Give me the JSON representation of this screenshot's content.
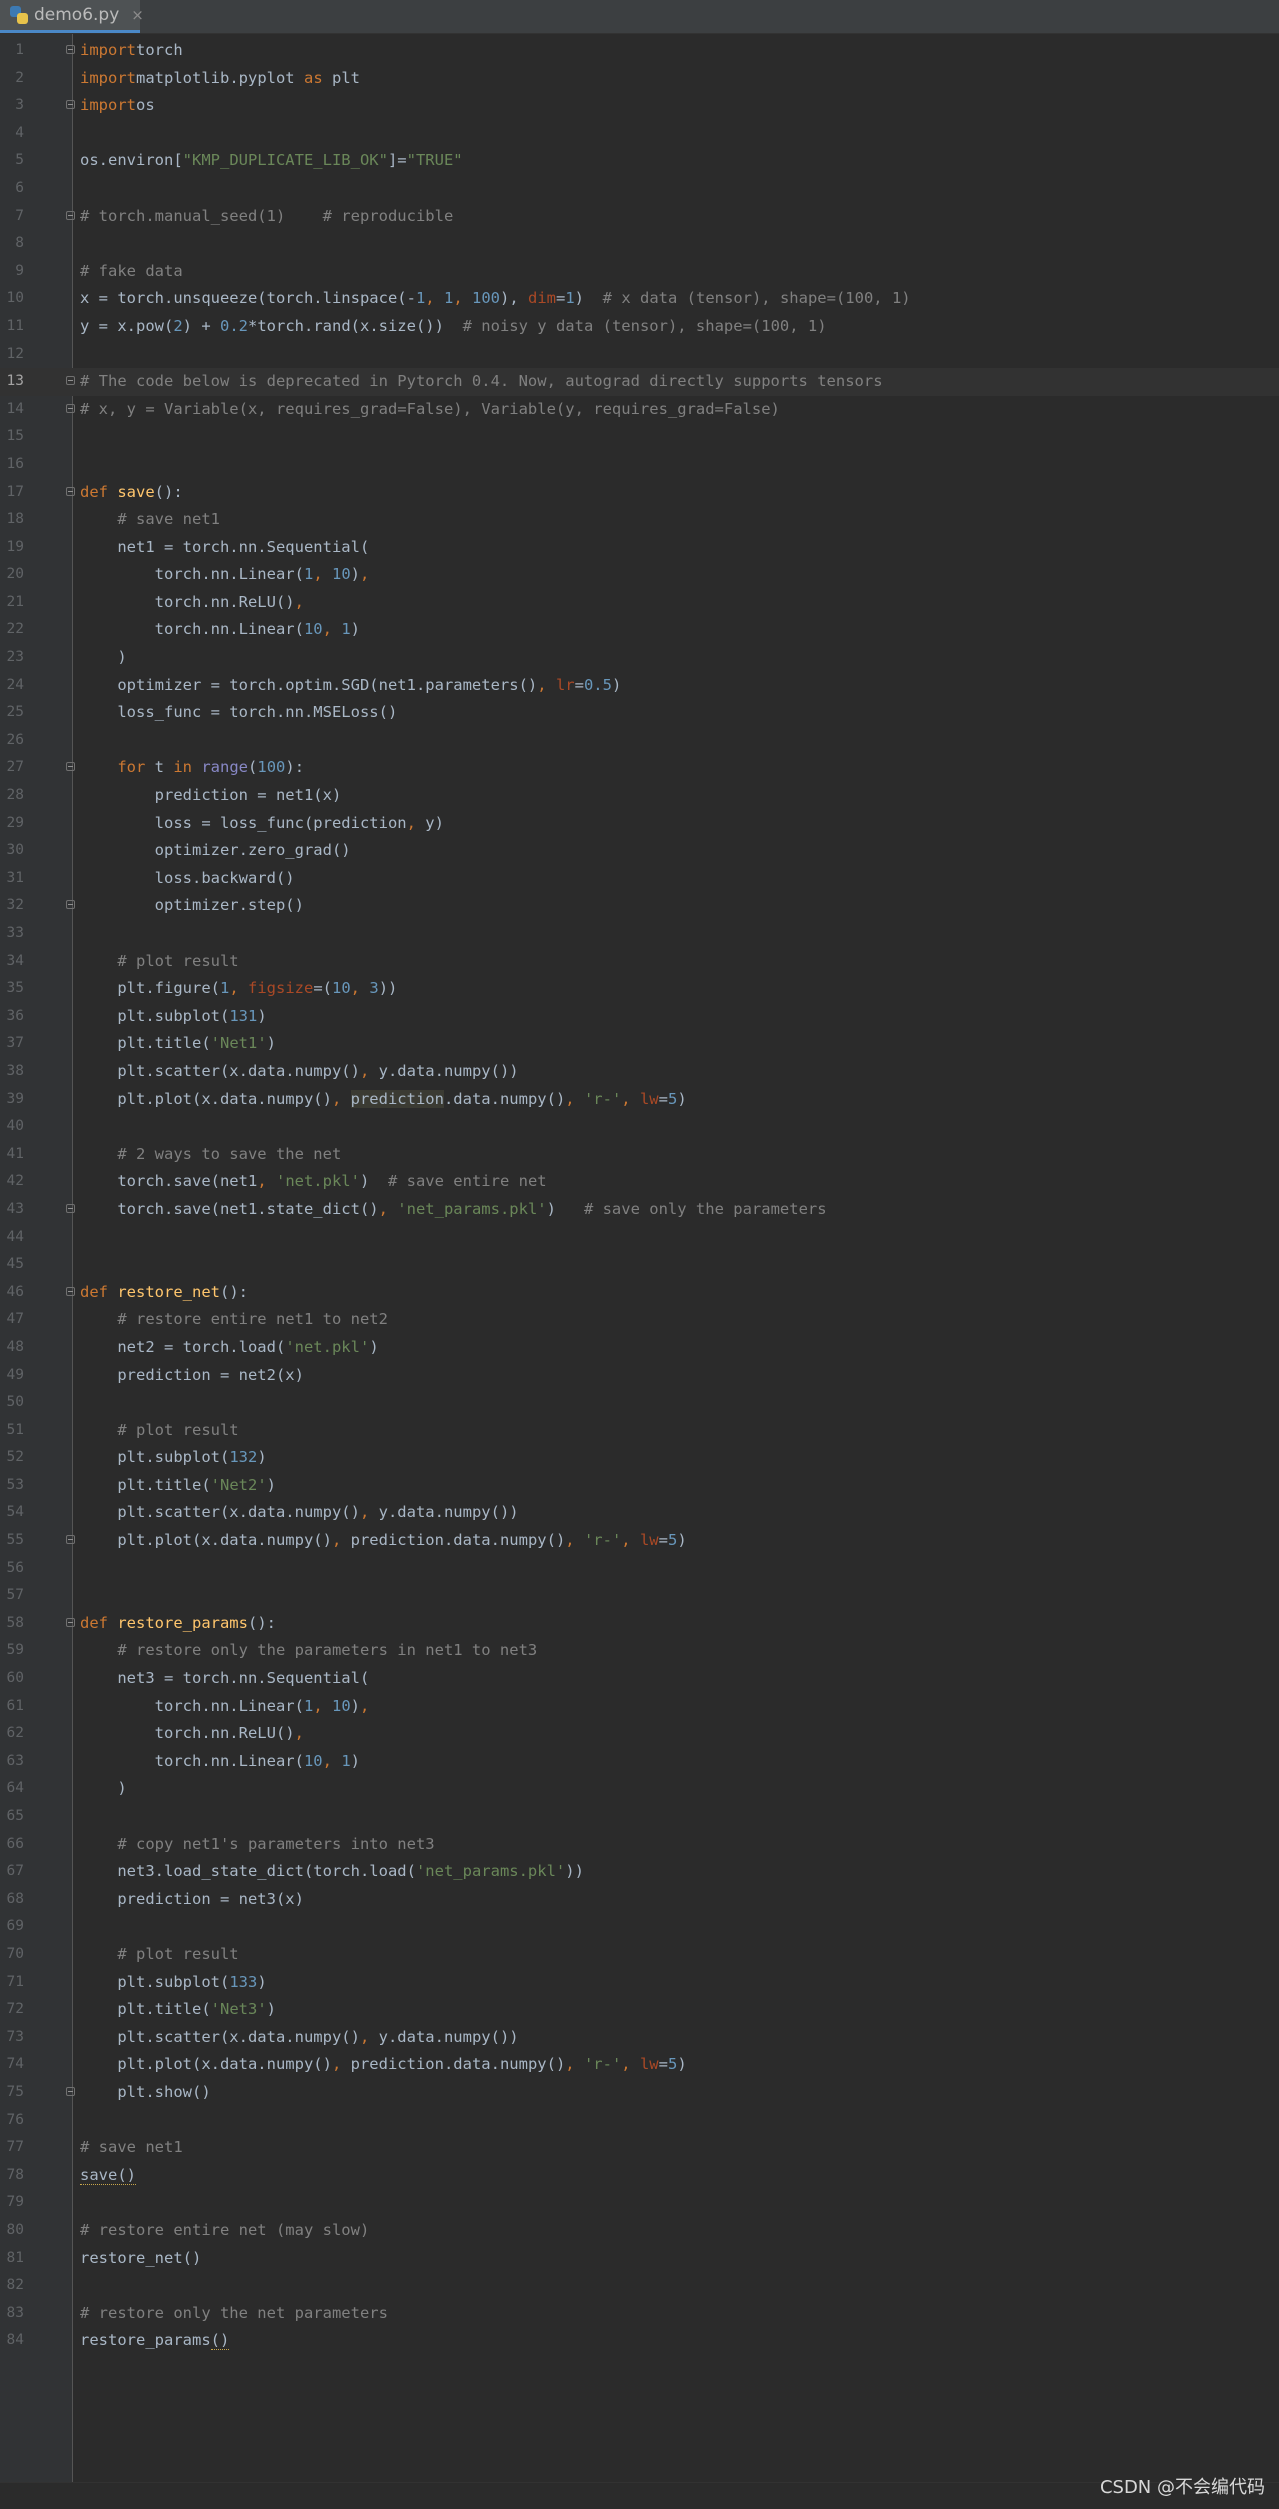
{
  "editor": {
    "tab": {
      "filename": "demo6.py",
      "icon": "python-file-icon",
      "close_glyph": "×"
    },
    "current_line": 13,
    "lines": [
      {
        "n": "1",
        "fold": true,
        "t": [
          [
            "kw",
            "import"
          ],
          [
            "",
            "torch"
          ]
        ]
      },
      {
        "n": "2",
        "t": [
          [
            "kw",
            "import"
          ],
          [
            "",
            "matplotlib.pyplot "
          ],
          [
            "kw",
            "as"
          ],
          [
            "",
            " plt"
          ]
        ]
      },
      {
        "n": "3",
        "fold": true,
        "t": [
          [
            "kw",
            "import"
          ],
          [
            "",
            "os"
          ]
        ]
      },
      {
        "n": "4",
        "t": []
      },
      {
        "n": "5",
        "t": [
          [
            "",
            "os.environ["
          ],
          [
            "st",
            "\"KMP_DUPLICATE_LIB_OK\""
          ],
          [
            "",
            "]="
          ],
          [
            "st",
            "\"TRUE\""
          ]
        ]
      },
      {
        "n": "6",
        "t": []
      },
      {
        "n": "7",
        "fold": true,
        "t": [
          [
            "cm",
            "# torch.manual_seed(1)    # reproducible"
          ]
        ]
      },
      {
        "n": "8",
        "t": []
      },
      {
        "n": "9",
        "t": [
          [
            "cm",
            "# fake data"
          ]
        ]
      },
      {
        "n": "10",
        "t": [
          [
            "",
            "x = torch.unsqueeze(torch.linspace(-"
          ],
          [
            "nm",
            "1"
          ],
          [
            "kw",
            ", "
          ],
          [
            "nm",
            "1"
          ],
          [
            "kw",
            ", "
          ],
          [
            "nm",
            "100"
          ],
          [
            "",
            "), "
          ],
          [
            "pr",
            "dim"
          ],
          [
            "",
            "="
          ],
          [
            "nm",
            "1"
          ],
          [
            "",
            ")  "
          ],
          [
            "cm",
            "# x data (tensor), shape=(100, 1)"
          ]
        ]
      },
      {
        "n": "11",
        "t": [
          [
            "",
            "y = x.pow("
          ],
          [
            "nm",
            "2"
          ],
          [
            "",
            ") + "
          ],
          [
            "nm",
            "0.2"
          ],
          [
            "",
            "*torch.rand(x.size())  "
          ],
          [
            "cm",
            "# noisy y data (tensor), shape=(100, 1)"
          ]
        ]
      },
      {
        "n": "12",
        "t": []
      },
      {
        "n": "13",
        "fold": true,
        "t": [
          [
            "cm",
            "# The code below is deprecated in Pytorch 0.4. Now, autograd directly supports tensors"
          ]
        ]
      },
      {
        "n": "14",
        "fold": true,
        "t": [
          [
            "cm",
            "# x, y = Variable(x, requires_grad=False), Variable(y, requires_grad=False)"
          ]
        ]
      },
      {
        "n": "15",
        "t": []
      },
      {
        "n": "16",
        "t": []
      },
      {
        "n": "17",
        "fold": true,
        "t": [
          [
            "kw",
            "def "
          ],
          [
            "fn",
            "save"
          ],
          [
            "",
            "():"
          ]
        ]
      },
      {
        "n": "18",
        "t": [
          [
            "",
            "    "
          ],
          [
            "cm",
            "# save net1"
          ]
        ]
      },
      {
        "n": "19",
        "t": [
          [
            "",
            "    net1 = torch.nn.Sequential("
          ]
        ]
      },
      {
        "n": "20",
        "t": [
          [
            "",
            "        torch.nn.Linear("
          ],
          [
            "nm",
            "1"
          ],
          [
            "kw",
            ", "
          ],
          [
            "nm",
            "10"
          ],
          [
            "",
            ")"
          ],
          [
            "kw",
            ","
          ]
        ]
      },
      {
        "n": "21",
        "t": [
          [
            "",
            "        torch.nn.ReLU()"
          ],
          [
            "kw",
            ","
          ]
        ]
      },
      {
        "n": "22",
        "t": [
          [
            "",
            "        torch.nn.Linear("
          ],
          [
            "nm",
            "10"
          ],
          [
            "kw",
            ", "
          ],
          [
            "nm",
            "1"
          ],
          [
            "",
            ")"
          ]
        ]
      },
      {
        "n": "23",
        "t": [
          [
            "",
            "    )"
          ]
        ]
      },
      {
        "n": "24",
        "t": [
          [
            "",
            "    optimizer = torch.optim.SGD(net1.parameters()"
          ],
          [
            "kw",
            ", "
          ],
          [
            "pr",
            "lr"
          ],
          [
            "",
            "="
          ],
          [
            "nm",
            "0.5"
          ],
          [
            "",
            ")"
          ]
        ]
      },
      {
        "n": "25",
        "t": [
          [
            "",
            "    loss_func = torch.nn.MSELoss()"
          ]
        ]
      },
      {
        "n": "26",
        "t": []
      },
      {
        "n": "27",
        "fold": true,
        "t": [
          [
            "",
            "    "
          ],
          [
            "kw",
            "for"
          ],
          [
            "",
            " t "
          ],
          [
            "kw",
            "in"
          ],
          [
            "",
            " "
          ],
          [
            "bi",
            "range"
          ],
          [
            "",
            "("
          ],
          [
            "nm",
            "100"
          ],
          [
            "",
            "):"
          ]
        ]
      },
      {
        "n": "28",
        "t": [
          [
            "",
            "        prediction = net1(x)"
          ]
        ]
      },
      {
        "n": "29",
        "t": [
          [
            "",
            "        loss = loss_func(prediction"
          ],
          [
            "kw",
            ", "
          ],
          [
            "",
            "y)"
          ]
        ]
      },
      {
        "n": "30",
        "t": [
          [
            "",
            "        optimizer.zero_grad()"
          ]
        ]
      },
      {
        "n": "31",
        "t": [
          [
            "",
            "        loss.backward()"
          ]
        ]
      },
      {
        "n": "32",
        "fold": true,
        "t": [
          [
            "",
            "        optimizer.step()"
          ]
        ]
      },
      {
        "n": "33",
        "t": []
      },
      {
        "n": "34",
        "t": [
          [
            "",
            "    "
          ],
          [
            "cm",
            "# plot result"
          ]
        ]
      },
      {
        "n": "35",
        "t": [
          [
            "",
            "    plt.figure("
          ],
          [
            "nm",
            "1"
          ],
          [
            "kw",
            ", "
          ],
          [
            "pr",
            "figsize"
          ],
          [
            "",
            "=("
          ],
          [
            "nm",
            "10"
          ],
          [
            "kw",
            ", "
          ],
          [
            "nm",
            "3"
          ],
          [
            "",
            "))"
          ]
        ]
      },
      {
        "n": "36",
        "t": [
          [
            "",
            "    plt.subplot("
          ],
          [
            "nm",
            "131"
          ],
          [
            "",
            ")"
          ]
        ]
      },
      {
        "n": "37",
        "t": [
          [
            "",
            "    plt.title("
          ],
          [
            "st",
            "'Net1'"
          ],
          [
            "",
            ")"
          ]
        ]
      },
      {
        "n": "38",
        "t": [
          [
            "",
            "    plt.scatter(x.data.numpy()"
          ],
          [
            "kw",
            ", "
          ],
          [
            "",
            "y.data.numpy())"
          ]
        ]
      },
      {
        "n": "39",
        "t": [
          [
            "",
            "    plt.plot(x.data.numpy()"
          ],
          [
            "kw",
            ", "
          ],
          [
            "hl",
            "prediction"
          ],
          [
            "",
            ".data.numpy()"
          ],
          [
            "kw",
            ", "
          ],
          [
            "st",
            "'r-'"
          ],
          [
            "kw",
            ", "
          ],
          [
            "pr",
            "lw"
          ],
          [
            "",
            "="
          ],
          [
            "nm",
            "5"
          ],
          [
            "",
            ")"
          ]
        ]
      },
      {
        "n": "40",
        "t": []
      },
      {
        "n": "41",
        "t": [
          [
            "",
            "    "
          ],
          [
            "cm",
            "# 2 ways to save the net"
          ]
        ]
      },
      {
        "n": "42",
        "t": [
          [
            "",
            "    torch.save(net1"
          ],
          [
            "kw",
            ", "
          ],
          [
            "st",
            "'net.pkl'"
          ],
          [
            "",
            ")  "
          ],
          [
            "cm",
            "# save entire net"
          ]
        ]
      },
      {
        "n": "43",
        "fold": true,
        "t": [
          [
            "",
            "    torch.save(net1.state_dict()"
          ],
          [
            "kw",
            ", "
          ],
          [
            "st",
            "'net_params.pkl'"
          ],
          [
            "",
            ")   "
          ],
          [
            "cm",
            "# save only the parameters"
          ]
        ]
      },
      {
        "n": "44",
        "t": []
      },
      {
        "n": "45",
        "t": []
      },
      {
        "n": "46",
        "fold": true,
        "t": [
          [
            "kw",
            "def "
          ],
          [
            "fn",
            "restore_net"
          ],
          [
            "",
            "():"
          ]
        ]
      },
      {
        "n": "47",
        "t": [
          [
            "",
            "    "
          ],
          [
            "cm",
            "# restore entire net1 to net2"
          ]
        ]
      },
      {
        "n": "48",
        "t": [
          [
            "",
            "    net2 = torch.load("
          ],
          [
            "st",
            "'net.pkl'"
          ],
          [
            "",
            ")"
          ]
        ]
      },
      {
        "n": "49",
        "t": [
          [
            "",
            "    prediction = net2(x)"
          ]
        ]
      },
      {
        "n": "50",
        "t": []
      },
      {
        "n": "51",
        "t": [
          [
            "",
            "    "
          ],
          [
            "cm",
            "# plot result"
          ]
        ]
      },
      {
        "n": "52",
        "t": [
          [
            "",
            "    plt.subplot("
          ],
          [
            "nm",
            "132"
          ],
          [
            "",
            ")"
          ]
        ]
      },
      {
        "n": "53",
        "t": [
          [
            "",
            "    plt.title("
          ],
          [
            "st",
            "'Net2'"
          ],
          [
            "",
            ")"
          ]
        ]
      },
      {
        "n": "54",
        "t": [
          [
            "",
            "    plt.scatter(x.data.numpy()"
          ],
          [
            "kw",
            ", "
          ],
          [
            "",
            "y.data.numpy())"
          ]
        ]
      },
      {
        "n": "55",
        "fold": true,
        "t": [
          [
            "",
            "    plt.plot(x.data.numpy()"
          ],
          [
            "kw",
            ", "
          ],
          [
            "",
            "prediction.data.numpy()"
          ],
          [
            "kw",
            ", "
          ],
          [
            "st",
            "'r-'"
          ],
          [
            "kw",
            ", "
          ],
          [
            "pr",
            "lw"
          ],
          [
            "",
            "="
          ],
          [
            "nm",
            "5"
          ],
          [
            "",
            ")"
          ]
        ]
      },
      {
        "n": "56",
        "t": []
      },
      {
        "n": "57",
        "t": []
      },
      {
        "n": "58",
        "fold": true,
        "t": [
          [
            "kw",
            "def "
          ],
          [
            "fn",
            "restore_params"
          ],
          [
            "",
            "():"
          ]
        ]
      },
      {
        "n": "59",
        "t": [
          [
            "",
            "    "
          ],
          [
            "cm",
            "# restore only the parameters in net1 to net3"
          ]
        ]
      },
      {
        "n": "60",
        "t": [
          [
            "",
            "    net3 = torch.nn.Sequential("
          ]
        ]
      },
      {
        "n": "61",
        "t": [
          [
            "",
            "        torch.nn.Linear("
          ],
          [
            "nm",
            "1"
          ],
          [
            "kw",
            ", "
          ],
          [
            "nm",
            "10"
          ],
          [
            "",
            ")"
          ],
          [
            "kw",
            ","
          ]
        ]
      },
      {
        "n": "62",
        "t": [
          [
            "",
            "        torch.nn.ReLU()"
          ],
          [
            "kw",
            ","
          ]
        ]
      },
      {
        "n": "63",
        "t": [
          [
            "",
            "        torch.nn.Linear("
          ],
          [
            "nm",
            "10"
          ],
          [
            "kw",
            ", "
          ],
          [
            "nm",
            "1"
          ],
          [
            "",
            ")"
          ]
        ]
      },
      {
        "n": "64",
        "t": [
          [
            "",
            "    )"
          ]
        ]
      },
      {
        "n": "65",
        "t": []
      },
      {
        "n": "66",
        "t": [
          [
            "",
            "    "
          ],
          [
            "cm",
            "# copy net1's parameters into net3"
          ]
        ]
      },
      {
        "n": "67",
        "t": [
          [
            "",
            "    net3.load_state_dict(torch.load("
          ],
          [
            "st",
            "'net_params.pkl'"
          ],
          [
            "",
            "))"
          ]
        ]
      },
      {
        "n": "68",
        "t": [
          [
            "",
            "    prediction = net3(x)"
          ]
        ]
      },
      {
        "n": "69",
        "t": []
      },
      {
        "n": "70",
        "t": [
          [
            "",
            "    "
          ],
          [
            "cm",
            "# plot result"
          ]
        ]
      },
      {
        "n": "71",
        "t": [
          [
            "",
            "    plt.subplot("
          ],
          [
            "nm",
            "133"
          ],
          [
            "",
            ")"
          ]
        ]
      },
      {
        "n": "72",
        "t": [
          [
            "",
            "    plt.title("
          ],
          [
            "st",
            "'Net3'"
          ],
          [
            "",
            ")"
          ]
        ]
      },
      {
        "n": "73",
        "t": [
          [
            "",
            "    plt.scatter(x.data.numpy()"
          ],
          [
            "kw",
            ", "
          ],
          [
            "",
            "y.data.numpy())"
          ]
        ]
      },
      {
        "n": "74",
        "t": [
          [
            "",
            "    plt.plot(x.data.numpy()"
          ],
          [
            "kw",
            ", "
          ],
          [
            "",
            "prediction.data.numpy()"
          ],
          [
            "kw",
            ", "
          ],
          [
            "st",
            "'r-'"
          ],
          [
            "kw",
            ", "
          ],
          [
            "pr",
            "lw"
          ],
          [
            "",
            "="
          ],
          [
            "nm",
            "5"
          ],
          [
            "",
            ")"
          ]
        ]
      },
      {
        "n": "75",
        "fold": true,
        "t": [
          [
            "",
            "    plt.show()"
          ]
        ]
      },
      {
        "n": "76",
        "t": []
      },
      {
        "n": "77",
        "t": [
          [
            "cm",
            "# save net1"
          ]
        ]
      },
      {
        "n": "78",
        "t": [
          [
            "wv",
            "save()"
          ]
        ]
      },
      {
        "n": "79",
        "t": []
      },
      {
        "n": "80",
        "t": [
          [
            "cm",
            "# restore entire net (may slow)"
          ]
        ]
      },
      {
        "n": "81",
        "t": [
          [
            "",
            "restore_net()"
          ]
        ]
      },
      {
        "n": "82",
        "t": []
      },
      {
        "n": "83",
        "t": [
          [
            "cm",
            "# restore only the net parameters"
          ]
        ]
      },
      {
        "n": "84",
        "t": [
          [
            "",
            "restore_params"
          ],
          [
            "wv",
            "()"
          ]
        ]
      }
    ]
  },
  "watermark": "CSDN @不会编代码"
}
